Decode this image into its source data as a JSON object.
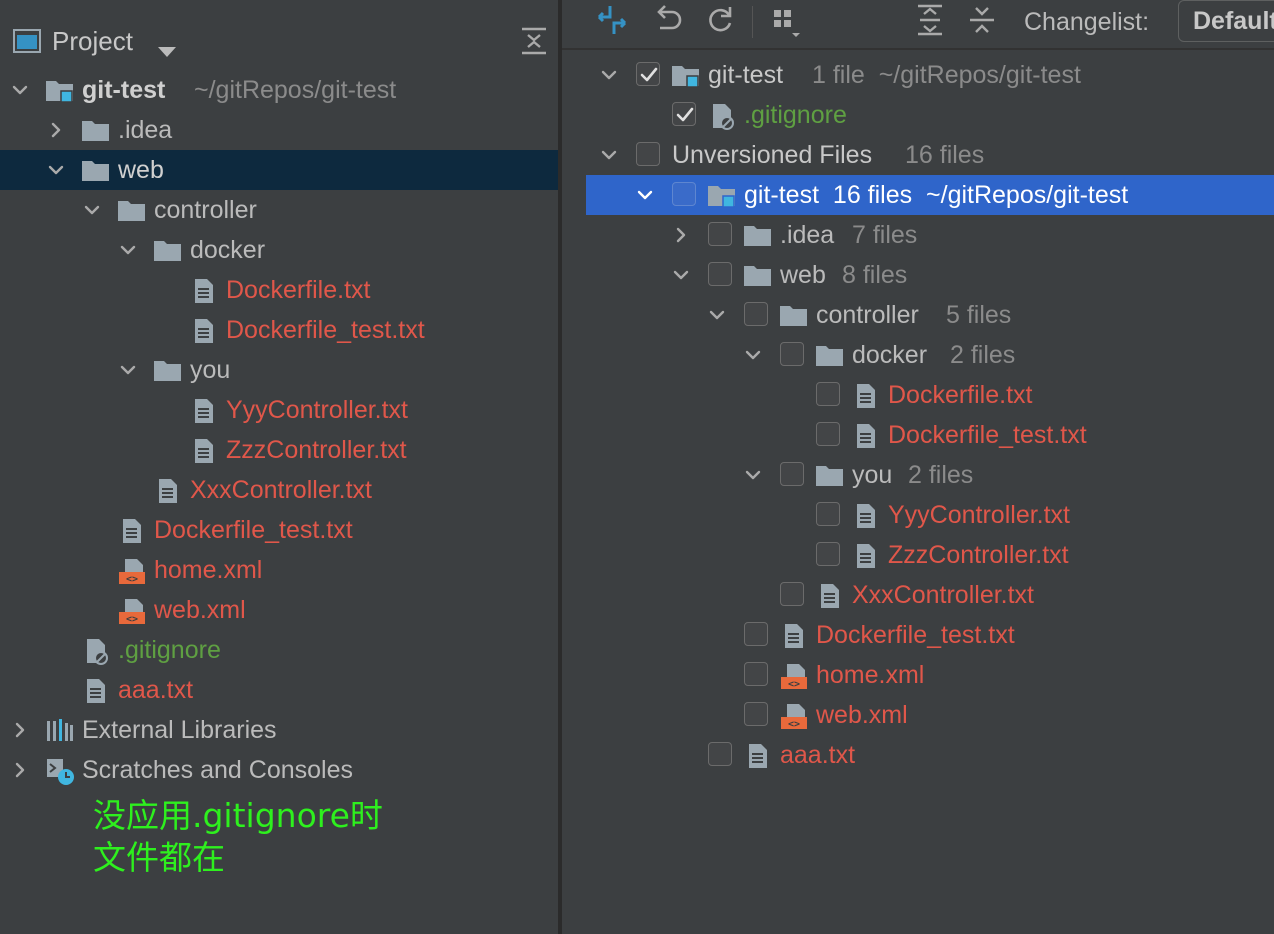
{
  "project_panel": {
    "title": "Project",
    "tree": [
      {
        "label": "git-test",
        "meta": "~/gitRepos/git-test"
      },
      {
        "label": ".idea"
      },
      {
        "label": "web"
      },
      {
        "label": "controller"
      },
      {
        "label": "docker"
      },
      {
        "label": "Dockerfile.txt"
      },
      {
        "label": "Dockerfile_test.txt"
      },
      {
        "label": "you"
      },
      {
        "label": "YyyController.txt"
      },
      {
        "label": "ZzzController.txt"
      },
      {
        "label": "XxxController.txt"
      },
      {
        "label": "Dockerfile_test.txt"
      },
      {
        "label": "home.xml"
      },
      {
        "label": "web.xml"
      },
      {
        "label": ".gitignore"
      },
      {
        "label": "aaa.txt"
      },
      {
        "label": "External Libraries"
      },
      {
        "label": "Scratches and Consoles"
      }
    ]
  },
  "annotation": {
    "line1": "没应用.gitignore时",
    "line2": "文件都在"
  },
  "commit_panel": {
    "changelist_label": "Changelist:",
    "changelist_value": "Default",
    "tree": [
      {
        "label": "git-test",
        "meta": "1 file  ~/gitRepos/git-test",
        "checked": true
      },
      {
        "label": ".gitignore",
        "checked": true
      },
      {
        "label": "Unversioned Files",
        "meta": "16 files",
        "checked": false
      },
      {
        "label": "git-test  16 files  ~/gitRepos/git-test",
        "checked": false
      },
      {
        "label": ".idea",
        "meta": "7 files",
        "checked": false
      },
      {
        "label": "web",
        "meta": "8 files",
        "checked": false
      },
      {
        "label": "controller",
        "meta": "5 files",
        "checked": false
      },
      {
        "label": "docker",
        "meta": "2 files",
        "checked": false
      },
      {
        "label": "Dockerfile.txt",
        "checked": false
      },
      {
        "label": "Dockerfile_test.txt",
        "checked": false
      },
      {
        "label": "you",
        "meta": "2 files",
        "checked": false
      },
      {
        "label": "YyyController.txt",
        "checked": false
      },
      {
        "label": "ZzzController.txt",
        "checked": false
      },
      {
        "label": "XxxController.txt",
        "checked": false
      },
      {
        "label": "Dockerfile_test.txt",
        "checked": false
      },
      {
        "label": "home.xml",
        "checked": false
      },
      {
        "label": "web.xml",
        "checked": false
      },
      {
        "label": "aaa.txt",
        "checked": false
      }
    ]
  },
  "colors": {
    "background": "#3c3f41",
    "selection_dark": "#0d293e",
    "selection_blue": "#2f65ca",
    "unversioned_text": "#e0574a",
    "ignored_text": "#5fa042",
    "annotation_text": "#2ef01e",
    "accent_icon": "#3592c4"
  }
}
